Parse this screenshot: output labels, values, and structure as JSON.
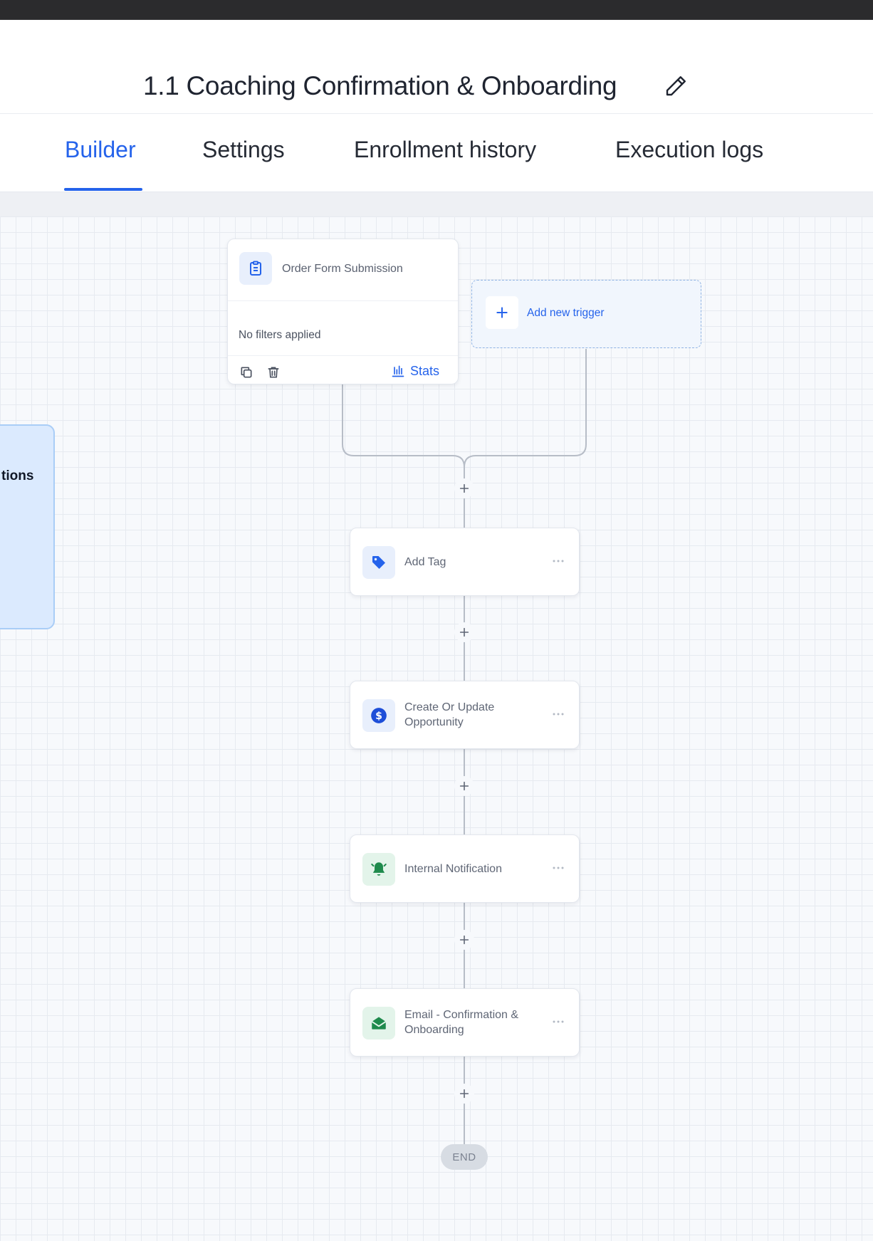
{
  "header": {
    "title": "1.1 Coaching Confirmation & Onboarding"
  },
  "tabs": [
    {
      "label": "Builder",
      "active": true
    },
    {
      "label": "Settings",
      "active": false
    },
    {
      "label": "Enrollment history",
      "active": false
    },
    {
      "label": "Execution logs",
      "active": false
    }
  ],
  "side_panel": {
    "label": "tions"
  },
  "trigger": {
    "title": "Order Form Submission",
    "filters": "No filters applied",
    "stats_label": "Stats",
    "icon": "clipboard-icon"
  },
  "add_trigger": {
    "label": "Add new trigger"
  },
  "actions": [
    {
      "title": "Add Tag",
      "icon": "tag-icon"
    },
    {
      "title": "Create Or Update Opportunity",
      "icon": "dollar-icon"
    },
    {
      "title": "Internal Notification",
      "icon": "bell-icon"
    },
    {
      "title": "Email - Confirmation & Onboarding",
      "icon": "mail-open-icon"
    }
  ],
  "end": {
    "label": "END"
  },
  "colors": {
    "accent": "#2563eb",
    "topbar": "#2b2b2d",
    "side_panel": "#dbeafe",
    "icon_blue_bg": "#e8effc",
    "icon_green_bg": "#e3f4ea",
    "icon_green": "#1e8a4c"
  }
}
